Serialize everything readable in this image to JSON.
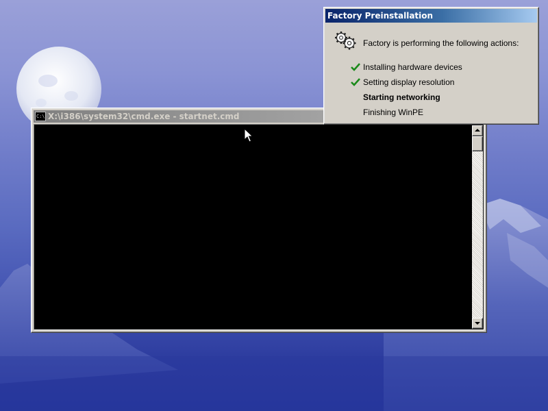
{
  "desktop": {
    "colors": {
      "sky_top": "#9aa0d8",
      "sky_bottom": "#23339a",
      "moon": "#e8ecf6",
      "mountain": "#4a5eb8"
    }
  },
  "cmd_window": {
    "title": "X:\\i386\\system32\\cmd.exe - startnet.cmd",
    "icon": "cmd-console-icon",
    "icon_text": "C:\\",
    "console_text": ""
  },
  "factory_dialog": {
    "title": "Factory Preinstallation",
    "icon": "gears-icon",
    "intro": "Factory is performing the following actions:",
    "steps": [
      {
        "label": "Installing hardware devices",
        "status": "done"
      },
      {
        "label": "Setting display resolution",
        "status": "done"
      },
      {
        "label": "Starting networking",
        "status": "in-progress"
      },
      {
        "label": "Finishing WinPE",
        "status": "pending"
      }
    ],
    "colors": {
      "titlebar_start": "#0a246a",
      "titlebar_end": "#a6caf0",
      "check": "#1a8a1a"
    }
  }
}
